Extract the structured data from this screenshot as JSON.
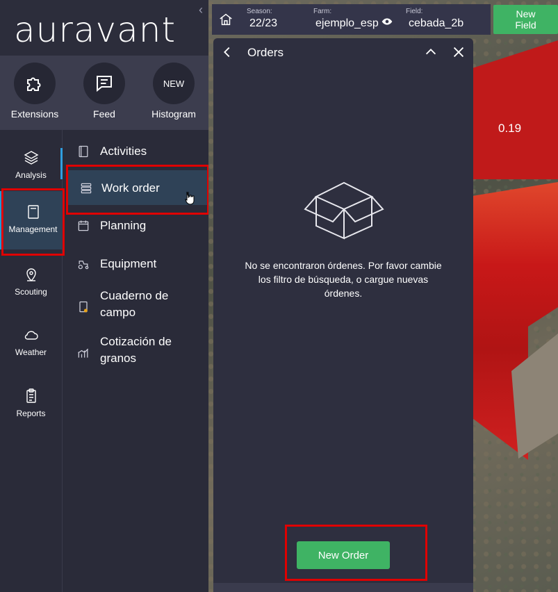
{
  "app": {
    "logo": "auravant"
  },
  "quick_actions": [
    {
      "label": "Extensions",
      "icon": "puzzle-icon"
    },
    {
      "label": "Feed",
      "icon": "feed-icon"
    },
    {
      "label": "Histogram",
      "icon": "new-badge",
      "badge": "NEW"
    }
  ],
  "nav": [
    {
      "label": "Analysis",
      "icon": "layers-icon"
    },
    {
      "label": "Management",
      "icon": "book-icon",
      "active": true
    },
    {
      "label": "Scouting",
      "icon": "pin-icon"
    },
    {
      "label": "Weather",
      "icon": "cloud-icon"
    },
    {
      "label": "Reports",
      "icon": "clipboard-icon"
    }
  ],
  "submenu": [
    {
      "label": "Activities",
      "icon": "notebook-icon"
    },
    {
      "label": "Work order",
      "icon": "server-icon",
      "active": true
    },
    {
      "label": "Planning",
      "icon": "calendar-icon"
    },
    {
      "label": "Equipment",
      "icon": "tractor-icon"
    },
    {
      "label": "Cuaderno de campo",
      "icon": "field-book-icon"
    },
    {
      "label": "Cotización de granos",
      "icon": "chart-icon"
    }
  ],
  "topbar": {
    "season": {
      "key": "Season:",
      "value": "22/23"
    },
    "farm": {
      "key": "Farm:",
      "value": "ejemplo_esp"
    },
    "field": {
      "key": "Field:",
      "value": "cebada_2b"
    },
    "new_field": "New Field"
  },
  "map": {
    "value_label": "0.19"
  },
  "panel": {
    "title": "Orders",
    "empty_message": "No se encontraron órdenes. Por favor cambie los filtro de búsqueda, o cargue nuevas órdenes.",
    "new_order": "New Order"
  },
  "colors": {
    "accent_green": "#3fb364",
    "highlight_red": "#e00000",
    "active_blue": "#2f4257"
  }
}
